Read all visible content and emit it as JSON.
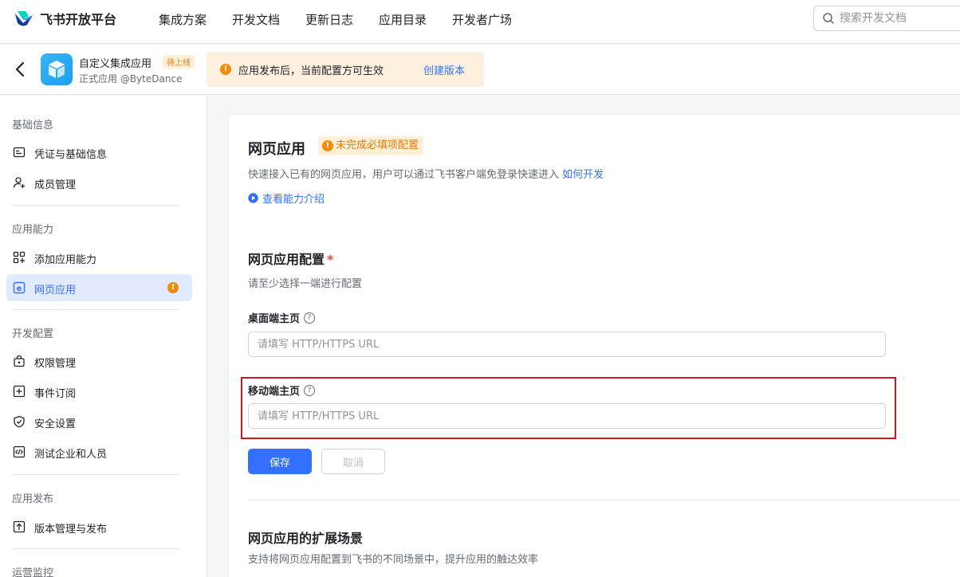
{
  "brand": {
    "name": "飞书开放平台"
  },
  "nav": {
    "items": [
      "集成方案",
      "开发文档",
      "更新日志",
      "应用目录",
      "开发者广场"
    ]
  },
  "search": {
    "placeholder": "搜索开发文档"
  },
  "app": {
    "name": "自定义集成应用",
    "badge": "待上线",
    "subtitle": "正式应用 @ByteDance",
    "notice": "应用发布后，当前配置方可生效",
    "notice_link": "创建版本"
  },
  "sidebar": {
    "sections": [
      {
        "title": "基础信息",
        "items": [
          {
            "label": "凭证与基础信息",
            "icon": "id-card-icon"
          },
          {
            "label": "成员管理",
            "icon": "add-member-icon"
          }
        ]
      },
      {
        "title": "应用能力",
        "items": [
          {
            "label": "添加应用能力",
            "icon": "apps-add-icon"
          },
          {
            "label": "网页应用",
            "icon": "web-app-icon",
            "active": true,
            "warning": true
          }
        ]
      },
      {
        "title": "开发配置",
        "items": [
          {
            "label": "权限管理",
            "icon": "lock-icon"
          },
          {
            "label": "事件订阅",
            "icon": "event-icon"
          },
          {
            "label": "安全设置",
            "icon": "shield-icon"
          },
          {
            "label": "测试企业和人员",
            "icon": "code-icon"
          }
        ]
      },
      {
        "title": "应用发布",
        "items": [
          {
            "label": "版本管理与发布",
            "icon": "upload-icon"
          }
        ]
      },
      {
        "title": "运营监控",
        "items": []
      }
    ]
  },
  "main": {
    "title": "网页应用",
    "status_tag": "未完成必填项配置",
    "description": "快速接入已有的网页应用，用户可以通过飞书客户端免登录快速进入",
    "description_link": "如何开发",
    "video_link": "查看能力介绍",
    "config_title": "网页应用配置",
    "required_mark": "*",
    "config_sub": "请至少选择一端进行配置",
    "desktop_label": "桌面端主页",
    "desktop_placeholder": "请填写 HTTP/HTTPS URL",
    "desktop_value": "",
    "mobile_label": "移动端主页",
    "mobile_placeholder": "请填写 HTTP/HTTPS URL",
    "mobile_value": "",
    "save_label": "保存",
    "cancel_label": "取消",
    "ext_title": "网页应用的扩展场景",
    "ext_sub": "支持将网页应用配置到飞书的不同场景中，提升应用的触达效率"
  },
  "colors": {
    "accent": "#3370ff",
    "warning": "#f08c0b",
    "highlight": "#d3141f"
  }
}
